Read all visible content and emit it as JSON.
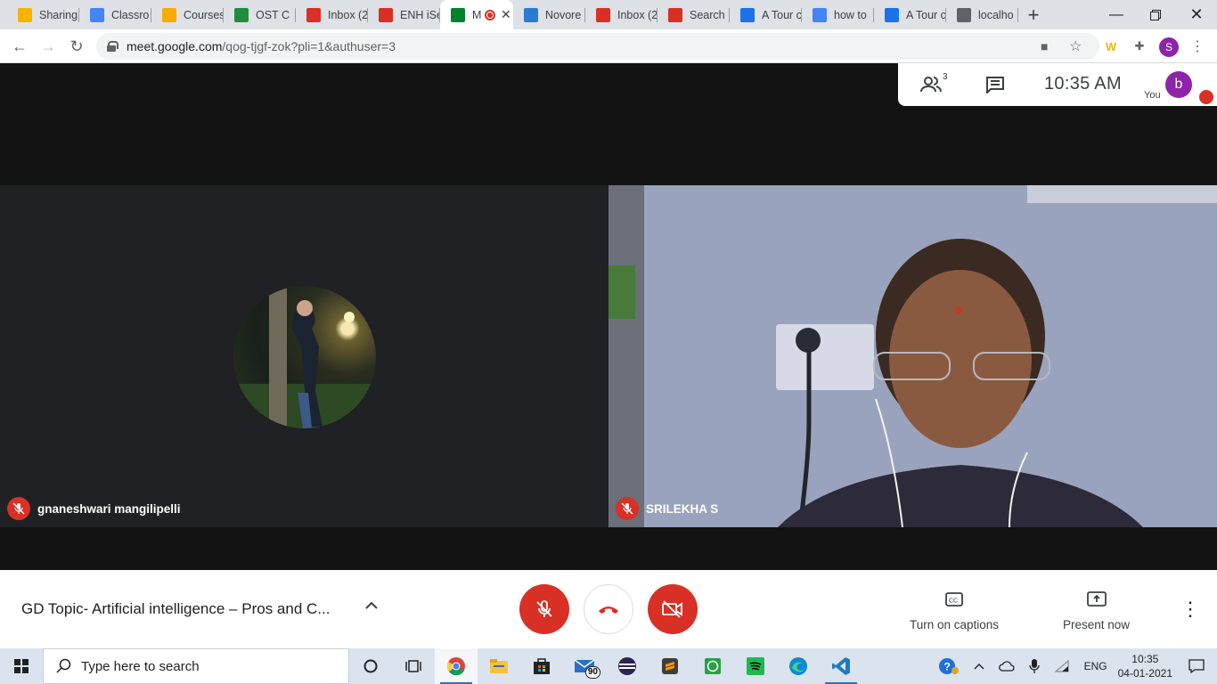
{
  "browser": {
    "tabs": [
      {
        "label": "Sharing",
        "icon": "pinwheel-icon",
        "color": "#f4b400"
      },
      {
        "label": "Classro",
        "icon": "google-icon",
        "color": "#4285f4"
      },
      {
        "label": "Courses",
        "icon": "classroom-icon",
        "color": "#f9ab00"
      },
      {
        "label": "OST C",
        "icon": "classroom-icon",
        "color": "#1e8e3e"
      },
      {
        "label": "Inbox (2",
        "icon": "gmail-icon",
        "color": "#d93025"
      },
      {
        "label": "ENH iSe",
        "icon": "gmail-icon",
        "color": "#d93025"
      },
      {
        "label": "M",
        "icon": "meet-icon",
        "color": "#00832d",
        "active": true
      },
      {
        "label": "Novore",
        "icon": "novorésumé-icon",
        "color": "#2b7bd5"
      },
      {
        "label": "Inbox (2",
        "icon": "gmail-icon",
        "color": "#d93025"
      },
      {
        "label": "Search",
        "icon": "gmail-icon",
        "color": "#d93025"
      },
      {
        "label": "A Tour c",
        "icon": "site-icon",
        "color": "#1a73e8"
      },
      {
        "label": "how to",
        "icon": "google-icon",
        "color": "#4285f4"
      },
      {
        "label": "A Tour c",
        "icon": "site-icon",
        "color": "#1a73e8"
      },
      {
        "label": "localho",
        "icon": "globe-icon",
        "color": "#5f6368"
      }
    ],
    "url_host": "meet.google.com",
    "url_path": "/qog-tjgf-zok?pli=1&authuser=3",
    "profile_initial": "S"
  },
  "meet": {
    "participant_count": "3",
    "time": "10:35  AM",
    "you_label": "You",
    "you_initial": "b",
    "tiles": [
      {
        "name": "gnaneshwari mangilipelli"
      },
      {
        "name": "SRILEKHA S"
      }
    ],
    "meeting_title": "GD Topic- Artificial intelligence – Pros and C...",
    "captions_label": "Turn on captions",
    "present_label": "Present now"
  },
  "taskbar": {
    "search_placeholder": "Type here to search",
    "language": "ENG",
    "time": "10:35",
    "date": "04-01-2021",
    "mail_badge": "90"
  }
}
